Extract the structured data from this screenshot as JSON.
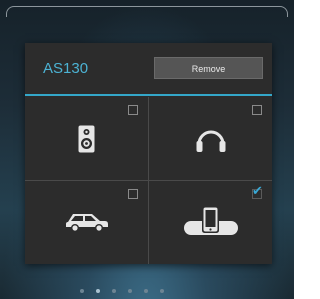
{
  "dialog": {
    "title": "AS130",
    "remove_label": "Remove"
  },
  "devices": [
    {
      "icon": "speaker-icon",
      "checked": false
    },
    {
      "icon": "headphones-icon",
      "checked": false
    },
    {
      "icon": "car-icon",
      "checked": false
    },
    {
      "icon": "phone-dock-icon",
      "checked": true
    }
  ],
  "pager": {
    "dots": 6,
    "active_index": 1
  },
  "colors": {
    "accent": "#34a7c9",
    "dialog_bg": "#2c2c2c",
    "check": "#39a9d6"
  }
}
